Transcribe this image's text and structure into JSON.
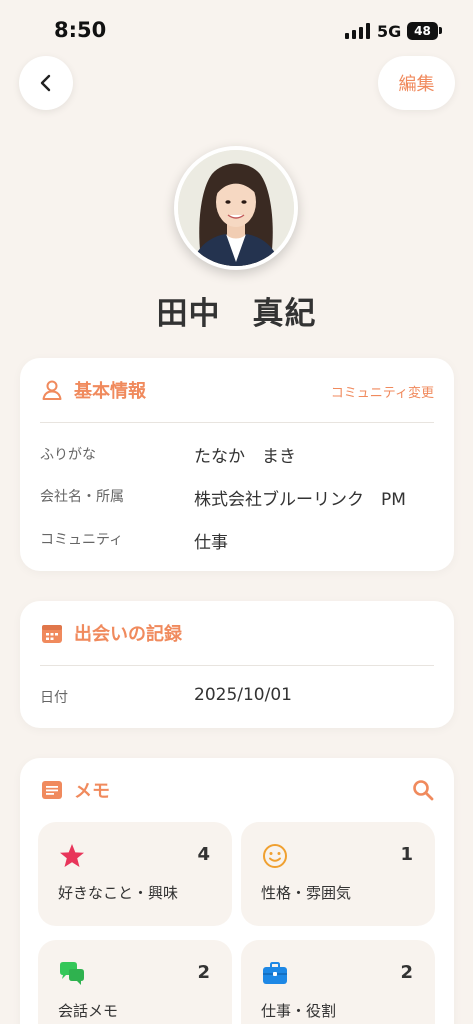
{
  "status_bar": {
    "time": "8:50",
    "network": "5G",
    "battery": "48"
  },
  "header": {
    "edit_label": "編集"
  },
  "profile": {
    "name": "田中　真紀"
  },
  "basic_info": {
    "title": "基本情報",
    "community_change_label": "コミュニティ変更",
    "rows": [
      {
        "label": "ふりがな",
        "value": "たなか　まき"
      },
      {
        "label": "会社名・所属",
        "value": "株式会社ブルーリンク　PM"
      },
      {
        "label": "コミュニティ",
        "value": "仕事"
      }
    ]
  },
  "meeting_record": {
    "title": "出会いの記録",
    "rows": [
      {
        "label": "日付",
        "value": "2025/10/01"
      }
    ]
  },
  "memo": {
    "title": "メモ",
    "tiles": [
      {
        "label": "好きなこと・興味",
        "count": "4",
        "icon": "star-icon",
        "color": "#e8355a"
      },
      {
        "label": "性格・雰囲気",
        "count": "1",
        "icon": "smiley-icon",
        "color": "#f0a030"
      },
      {
        "label": "会話メモ",
        "count": "2",
        "icon": "chat-bubbles-icon",
        "color": "#34c759"
      },
      {
        "label": "仕事・役割",
        "count": "2",
        "icon": "briefcase-icon",
        "color": "#1e88e5"
      }
    ]
  },
  "colors": {
    "accent": "#f08a5d",
    "background": "#f8f3ee",
    "card": "#ffffff"
  }
}
